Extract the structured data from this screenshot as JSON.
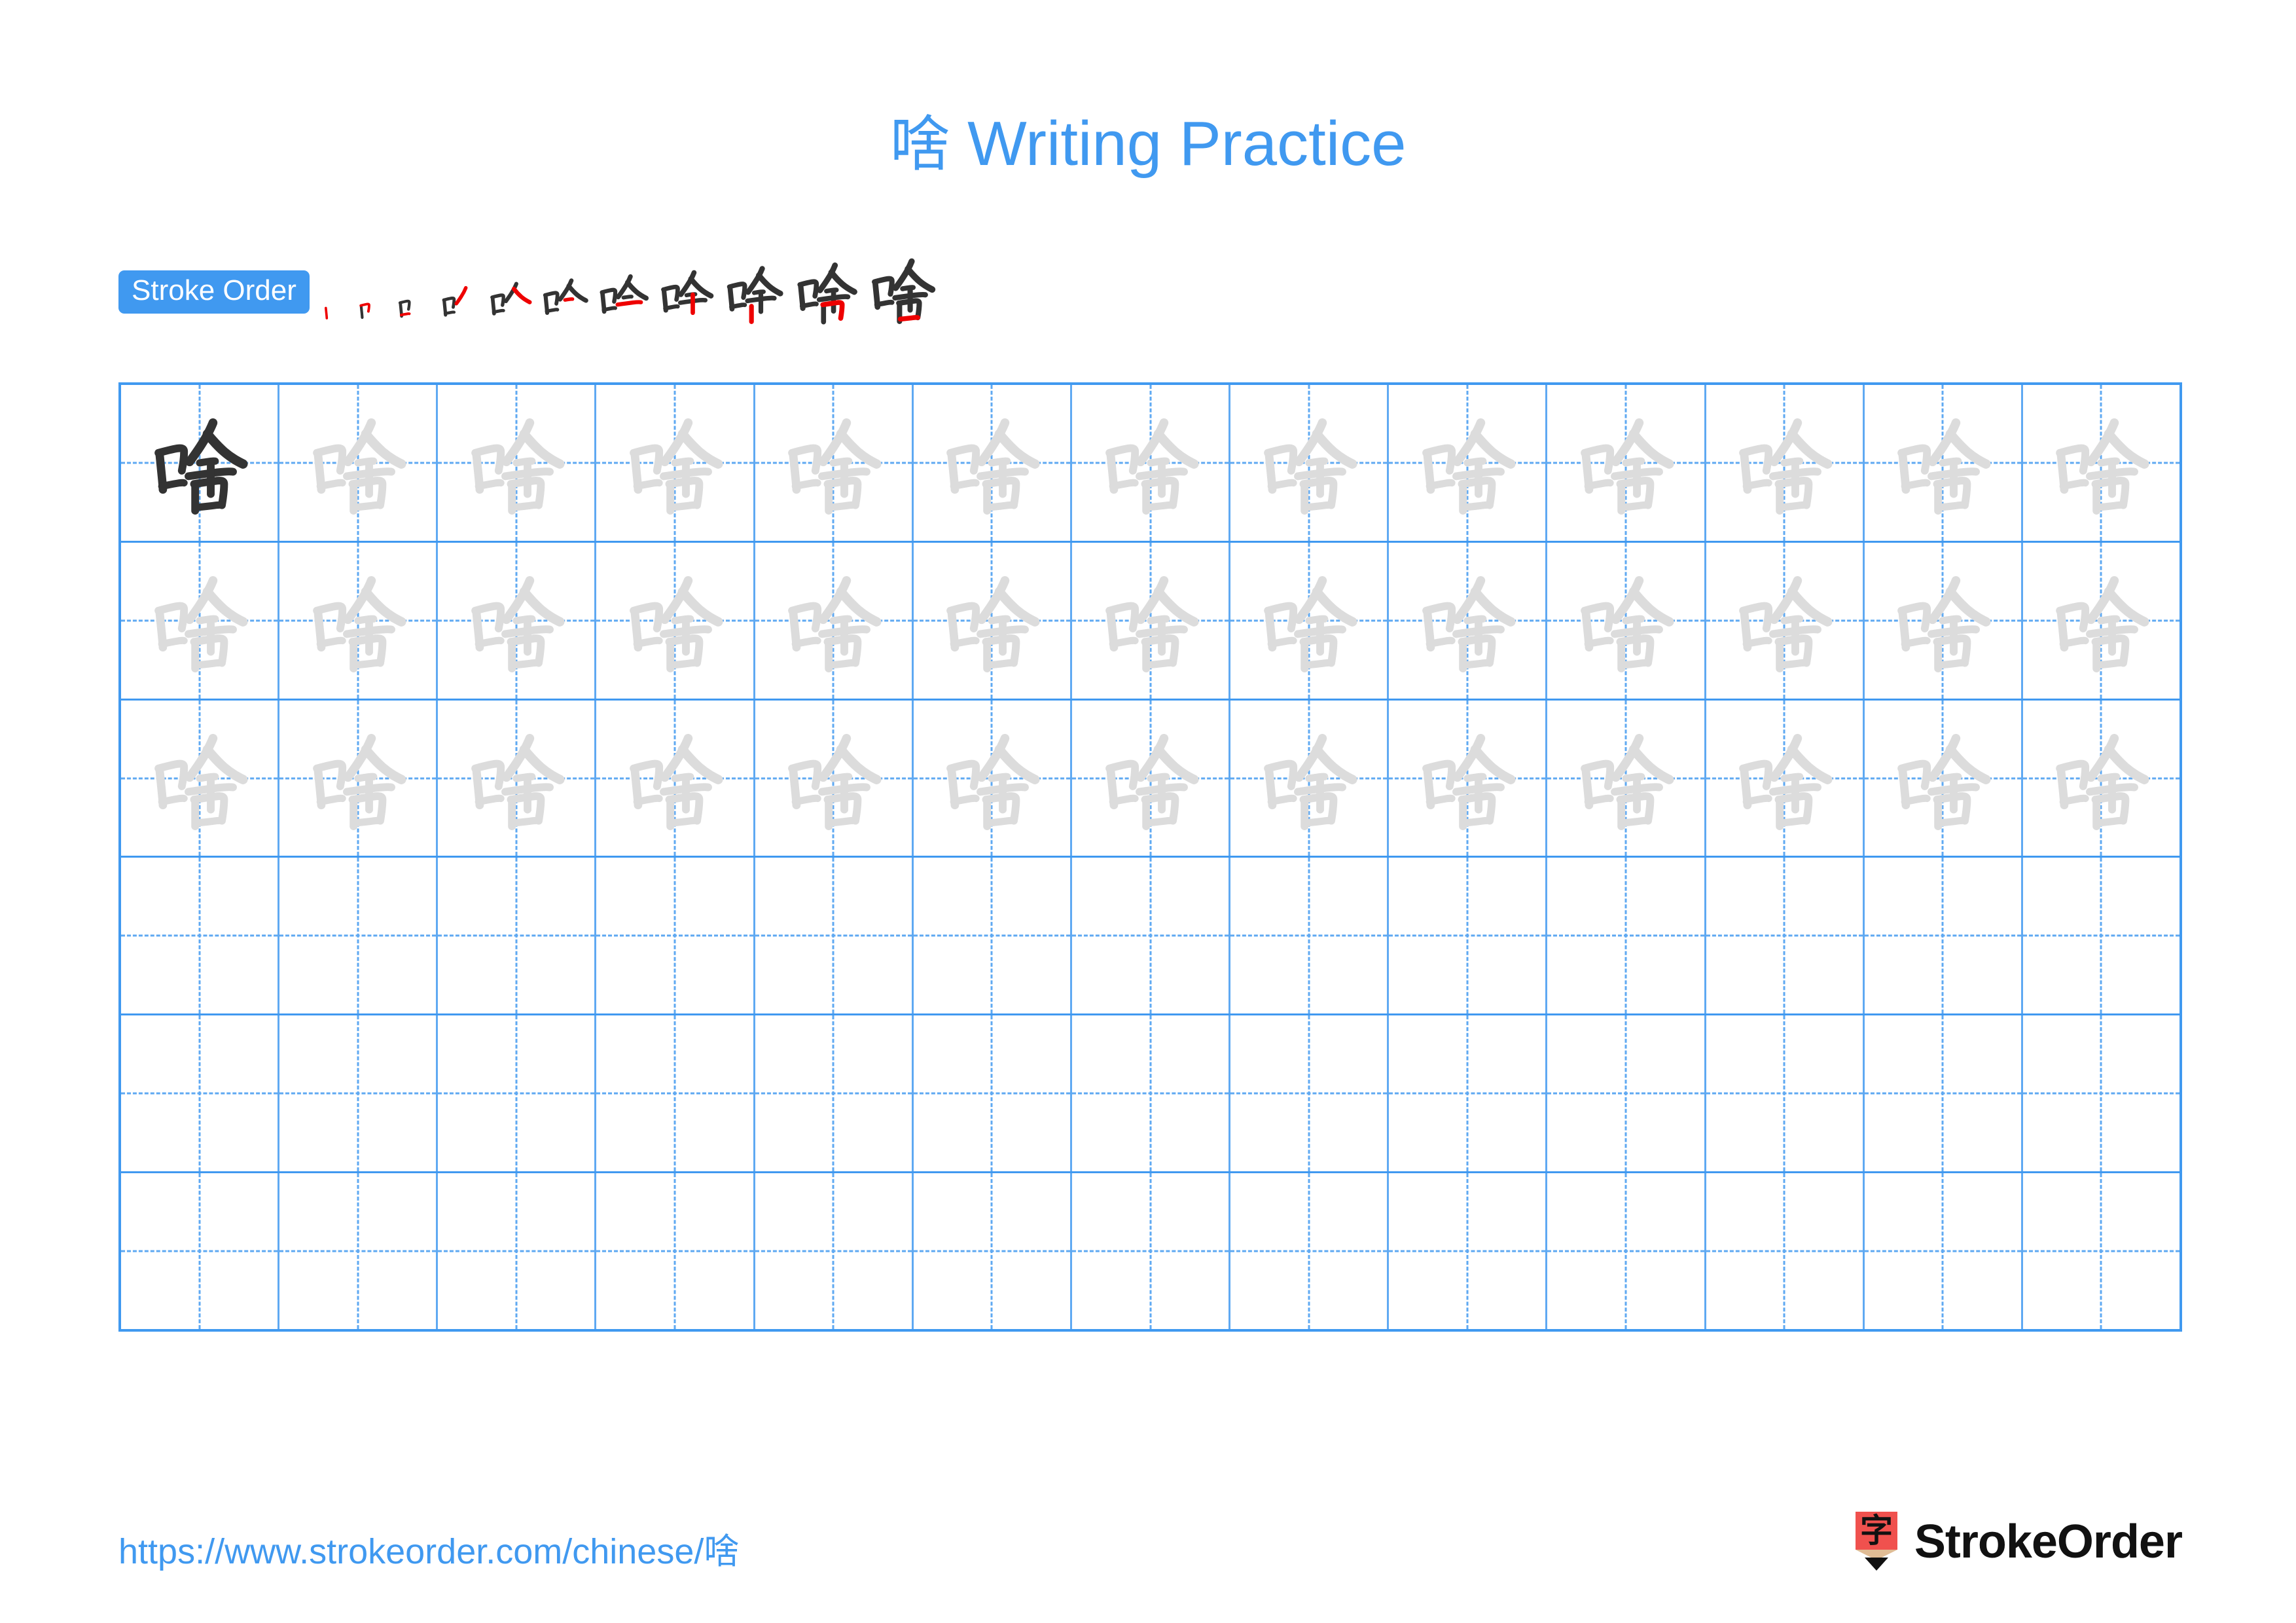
{
  "title": {
    "character": "啥",
    "text": " Writing Practice",
    "color": "#4099F0"
  },
  "stroke_order": {
    "badge_label": "Stroke Order",
    "badge_bg": "#4099F0",
    "badge_text_color": "#ffffff",
    "character": "啥",
    "total_strokes": 11,
    "ink_color": "#333333",
    "highlight_color": "#EE0000",
    "steps": [
      {
        "index": 1,
        "strokes_shown": 1,
        "new_stroke": "dian-vertical-left"
      },
      {
        "index": 2,
        "strokes_shown": 2,
        "new_stroke": "hengzhe-top"
      },
      {
        "index": 3,
        "strokes_shown": 3,
        "new_stroke": "heng-bottom-kou"
      },
      {
        "index": 4,
        "strokes_shown": 4,
        "new_stroke": "pie-right-top"
      },
      {
        "index": 5,
        "strokes_shown": 5,
        "new_stroke": "na-right"
      },
      {
        "index": 6,
        "strokes_shown": 6,
        "new_stroke": "heng-short-mid"
      },
      {
        "index": 7,
        "strokes_shown": 7,
        "new_stroke": "heng-long"
      },
      {
        "index": 8,
        "strokes_shown": 8,
        "new_stroke": "shu-center"
      },
      {
        "index": 9,
        "strokes_shown": 9,
        "new_stroke": "shu-left-kou"
      },
      {
        "index": 10,
        "strokes_shown": 10,
        "new_stroke": "hengzhe-kou"
      },
      {
        "index": 11,
        "strokes_shown": 11,
        "new_stroke": "heng-close-kou"
      }
    ]
  },
  "grid": {
    "rows": 6,
    "columns": 13,
    "line_color": "#4099F0",
    "guide_color": "#5FA9F2",
    "model_char_color": "#333333",
    "trace_char_color": "#DCDCDC",
    "character": "啥",
    "cells": [
      [
        "model",
        "trace",
        "trace",
        "trace",
        "trace",
        "trace",
        "trace",
        "trace",
        "trace",
        "trace",
        "trace",
        "trace",
        "trace"
      ],
      [
        "trace",
        "trace",
        "trace",
        "trace",
        "trace",
        "trace",
        "trace",
        "trace",
        "trace",
        "trace",
        "trace",
        "trace",
        "trace"
      ],
      [
        "trace",
        "trace",
        "trace",
        "trace",
        "trace",
        "trace",
        "trace",
        "trace",
        "trace",
        "trace",
        "trace",
        "trace",
        "trace"
      ],
      [
        "empty",
        "empty",
        "empty",
        "empty",
        "empty",
        "empty",
        "empty",
        "empty",
        "empty",
        "empty",
        "empty",
        "empty",
        "empty"
      ],
      [
        "empty",
        "empty",
        "empty",
        "empty",
        "empty",
        "empty",
        "empty",
        "empty",
        "empty",
        "empty",
        "empty",
        "empty",
        "empty"
      ],
      [
        "empty",
        "empty",
        "empty",
        "empty",
        "empty",
        "empty",
        "empty",
        "empty",
        "empty",
        "empty",
        "empty",
        "empty",
        "empty"
      ]
    ]
  },
  "footer": {
    "url": "https://www.strokeorder.com/chinese/啥",
    "url_color": "#4099F0",
    "brand_name": "StrokeOrder",
    "logo_icon": "pencil-zi-icon",
    "logo_char": "字",
    "logo_body_color": "#F0514E",
    "logo_wood_color": "#E0BC95",
    "logo_tip_color": "#111111"
  }
}
